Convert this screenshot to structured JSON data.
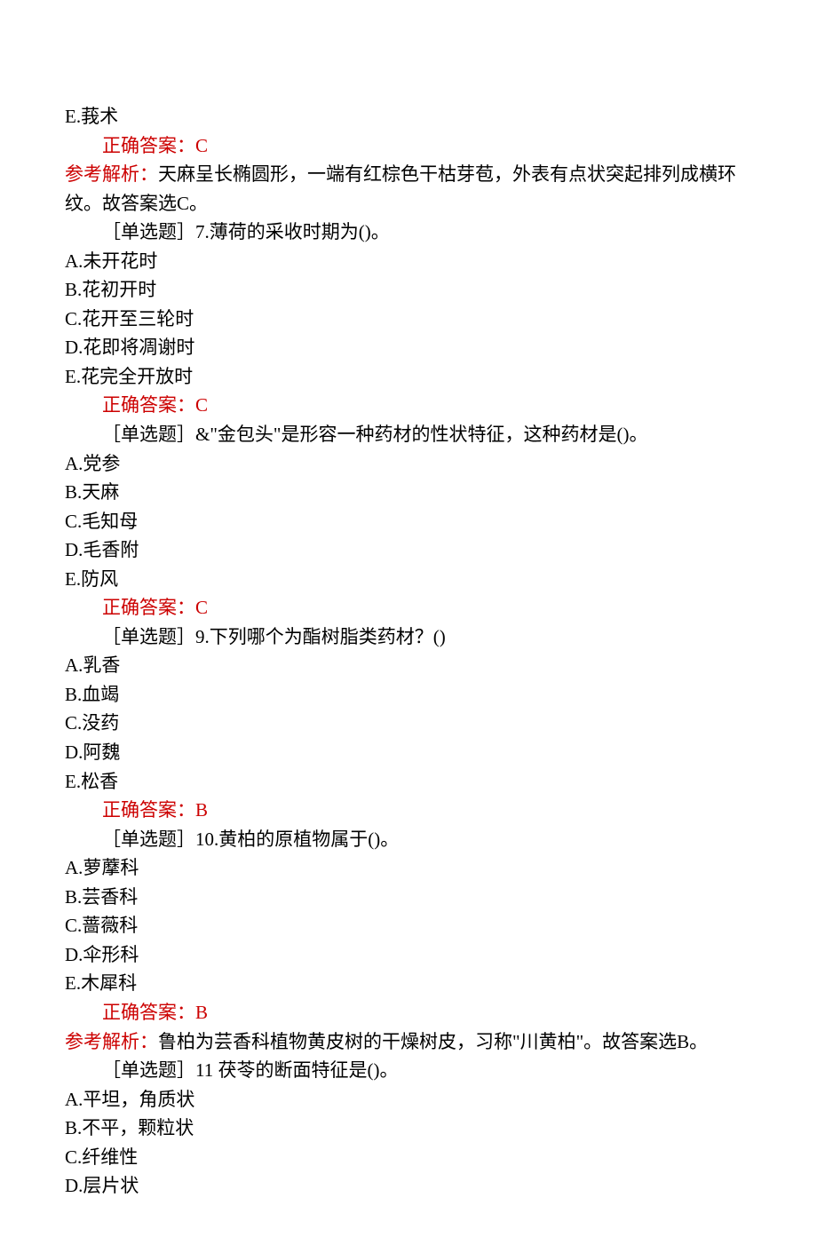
{
  "lines": [
    {
      "text": "E.莪术",
      "indent": false,
      "class": ""
    },
    {
      "text": "正确答案：C",
      "indent": true,
      "class": "red"
    },
    {
      "text": "",
      "indent": false,
      "class": "",
      "parts": [
        {
          "text": "参考解析：",
          "class": "red-label"
        },
        {
          "text": "天麻呈长椭圆形，一端有红棕色干枯芽苞，外表有点状突起排列成横环纹。故答案选C。",
          "class": ""
        }
      ]
    },
    {
      "text": "［单选题］7.薄荷的采收时期为()。",
      "indent": true,
      "class": ""
    },
    {
      "text": "A.未开花时",
      "indent": false,
      "class": ""
    },
    {
      "text": "B.花初开时",
      "indent": false,
      "class": ""
    },
    {
      "text": "C.花开至三轮时",
      "indent": false,
      "class": ""
    },
    {
      "text": "D.花即将凋谢时",
      "indent": false,
      "class": ""
    },
    {
      "text": "E.花完全开放时",
      "indent": false,
      "class": ""
    },
    {
      "text": "正确答案：C",
      "indent": true,
      "class": "red"
    },
    {
      "text": "［单选题］&\"金包头\"是形容一种药材的性状特征，这种药材是()。",
      "indent": true,
      "class": ""
    },
    {
      "text": "A.党参",
      "indent": false,
      "class": ""
    },
    {
      "text": "B.天麻",
      "indent": false,
      "class": ""
    },
    {
      "text": "C.毛知母",
      "indent": false,
      "class": ""
    },
    {
      "text": "D.毛香附",
      "indent": false,
      "class": ""
    },
    {
      "text": "E.防风",
      "indent": false,
      "class": ""
    },
    {
      "text": "正确答案：C",
      "indent": true,
      "class": "red"
    },
    {
      "text": "［单选题］9.下列哪个为酯树脂类药材？()",
      "indent": true,
      "class": ""
    },
    {
      "text": "A.乳香",
      "indent": false,
      "class": ""
    },
    {
      "text": "B.血竭",
      "indent": false,
      "class": ""
    },
    {
      "text": "C.没药",
      "indent": false,
      "class": ""
    },
    {
      "text": "D.阿魏",
      "indent": false,
      "class": ""
    },
    {
      "text": "E.松香",
      "indent": false,
      "class": ""
    },
    {
      "text": "正确答案：B",
      "indent": true,
      "class": "red"
    },
    {
      "text": "［单选题］10.黄柏的原植物属于()。",
      "indent": true,
      "class": ""
    },
    {
      "text": "A.萝藦科",
      "indent": false,
      "class": ""
    },
    {
      "text": "B.芸香科",
      "indent": false,
      "class": ""
    },
    {
      "text": "C.蔷薇科",
      "indent": false,
      "class": ""
    },
    {
      "text": "D.伞形科",
      "indent": false,
      "class": ""
    },
    {
      "text": "E.木犀科",
      "indent": false,
      "class": ""
    },
    {
      "text": "正确答案：B",
      "indent": true,
      "class": "red"
    },
    {
      "text": "",
      "indent": false,
      "class": "",
      "parts": [
        {
          "text": "参考解析：",
          "class": "red-label"
        },
        {
          "text": "鲁柏为芸香科植物黄皮树的干燥树皮，习称\"川黄柏\"。故答案选B。",
          "class": ""
        }
      ]
    },
    {
      "text": "［单选题］11 茯苓的断面特征是()。",
      "indent": true,
      "class": ""
    },
    {
      "text": "A.平坦，角质状",
      "indent": false,
      "class": ""
    },
    {
      "text": "B.不平，颗粒状",
      "indent": false,
      "class": ""
    },
    {
      "text": "C.纤维性",
      "indent": false,
      "class": ""
    },
    {
      "text": "D.层片状",
      "indent": false,
      "class": ""
    }
  ]
}
